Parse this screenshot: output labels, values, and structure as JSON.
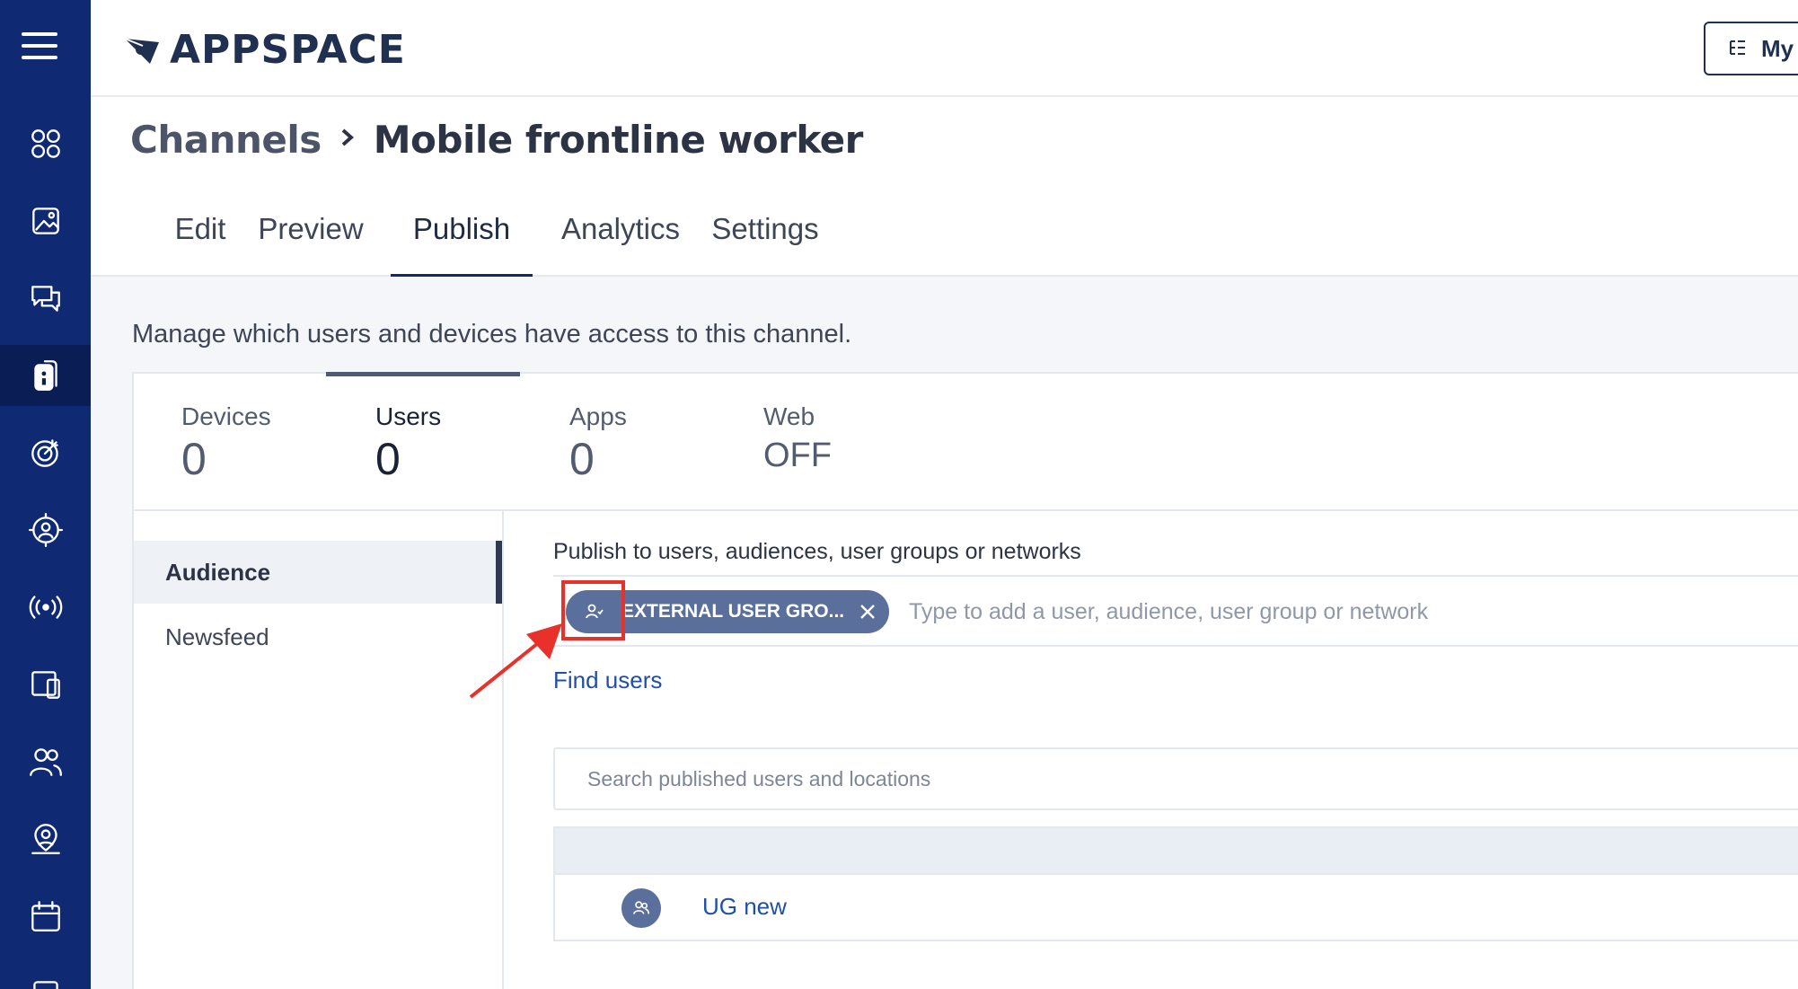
{
  "app": {
    "name": "APPSPACE",
    "brand_color": "#0f2a72"
  },
  "header": {
    "my_button_label": "My"
  },
  "sidebar": {
    "icons": [
      "menu-icon",
      "dashboard-icon",
      "library-icon",
      "messages-icon",
      "channels-icon",
      "goals-icon",
      "audience-icon",
      "broadcast-icon",
      "devices-icon",
      "users-icon",
      "locations-icon",
      "calendar-icon"
    ],
    "active": "channels-icon"
  },
  "breadcrumb": {
    "parent": "Channels",
    "current": "Mobile frontline worker"
  },
  "tabs": [
    "Edit",
    "Preview",
    "Publish",
    "Analytics",
    "Settings"
  ],
  "active_tab": "Publish",
  "description": "Manage which users and devices have access to this channel.",
  "stats": [
    {
      "label": "Devices",
      "value": "0"
    },
    {
      "label": "Users",
      "value": "0"
    },
    {
      "label": "Apps",
      "value": "0"
    },
    {
      "label": "Web",
      "value": "OFF"
    }
  ],
  "active_stat": "Users",
  "side_menu": [
    "Audience",
    "Newsfeed"
  ],
  "active_side": "Audience",
  "publish": {
    "label": "Publish to users, audiences, user groups or networks",
    "chip_label": "EXTERNAL USER GRO...",
    "input_placeholder": "Type to add a user, audience, user group or network",
    "find_users": "Find users",
    "highlight_color": "#e8312a"
  },
  "search": {
    "placeholder": "Search published users and locations"
  },
  "table": {
    "rows": [
      {
        "name": "UG new",
        "icon": "user-group-icon"
      }
    ]
  }
}
